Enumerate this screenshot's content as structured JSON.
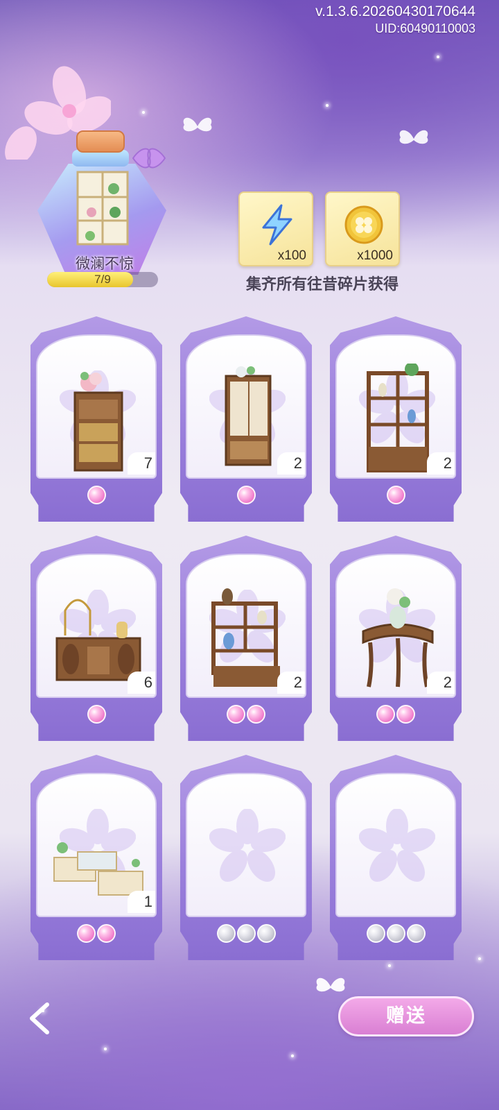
{
  "header": {
    "version": "v.1.3.6.20260430170644",
    "uid": "UID:60490110003"
  },
  "collection": {
    "name": "微澜不惊",
    "progress_text": "7/9",
    "progress_fraction": 0.778
  },
  "rewards": {
    "items": [
      {
        "icon": "lightning-icon",
        "count": "x100"
      },
      {
        "icon": "clover-coin-icon",
        "count": "x1000"
      }
    ],
    "caption": "集齐所有往昔碎片获得"
  },
  "cards": [
    {
      "item": "flower-cabinet",
      "count": "7",
      "orbs": [
        "pink"
      ]
    },
    {
      "item": "wardrobe",
      "count": "2",
      "orbs": [
        "pink"
      ]
    },
    {
      "item": "curio-shelf",
      "count": "2",
      "orbs": [
        "pink"
      ]
    },
    {
      "item": "birdcage-sideboard",
      "count": "6",
      "orbs": [
        "pink"
      ]
    },
    {
      "item": "vase-shelf",
      "count": "2",
      "orbs": [
        "pink",
        "pink"
      ]
    },
    {
      "item": "half-moon-table",
      "count": "2",
      "orbs": [
        "pink",
        "pink"
      ]
    },
    {
      "item": "counter",
      "count": "1",
      "orbs": [
        "pink",
        "pink"
      ]
    },
    {
      "item": "empty",
      "count": "",
      "orbs": [
        "grey",
        "grey",
        "grey"
      ]
    },
    {
      "item": "empty",
      "count": "",
      "orbs": [
        "grey",
        "grey",
        "grey"
      ]
    }
  ],
  "footer": {
    "back_icon": "back-arrow-icon",
    "gift_label": "赠送"
  },
  "colors": {
    "accent_purple": "#9a7fdc",
    "button_pink": "#e08fd8",
    "progress_yellow": "#f2d84a"
  }
}
